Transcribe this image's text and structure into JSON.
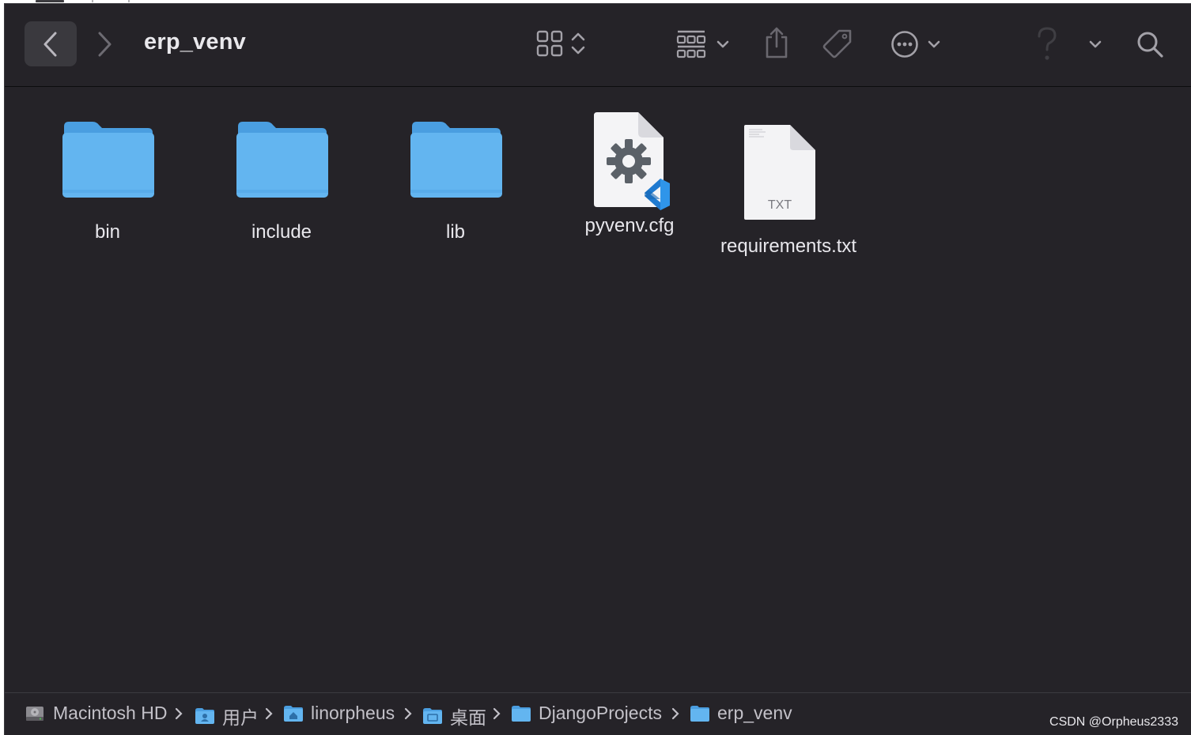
{
  "window": {
    "title": "erp_venv"
  },
  "toolbar": {
    "back": "back",
    "forward": "forward",
    "view_mode": "icon-view",
    "group": "group",
    "share": "share",
    "tags": "tags",
    "more": "more",
    "help": "?",
    "search": "search"
  },
  "items": [
    {
      "name": "bin",
      "kind": "folder"
    },
    {
      "name": "include",
      "kind": "folder"
    },
    {
      "name": "lib",
      "kind": "folder"
    },
    {
      "name": "pyvenv.cfg",
      "kind": "cfg-file"
    },
    {
      "name": "requirements.txt",
      "kind": "txt-file",
      "badge": "TXT"
    }
  ],
  "pathbar": [
    {
      "label": "Macintosh HD",
      "icon": "hard-drive-icon"
    },
    {
      "label": "用户",
      "icon": "users-folder-icon"
    },
    {
      "label": "linorpheus",
      "icon": "home-folder-icon"
    },
    {
      "label": "桌面",
      "icon": "desktop-folder-icon"
    },
    {
      "label": "DjangoProjects",
      "icon": "folder-icon"
    },
    {
      "label": "erp_venv",
      "icon": "folder-icon"
    }
  ],
  "watermark": "CSDN @Orpheus2333",
  "colors": {
    "window_bg": "#252328",
    "folder": "#63b5f0",
    "text": "#e8e7ec",
    "icon": "#9f9da4"
  }
}
